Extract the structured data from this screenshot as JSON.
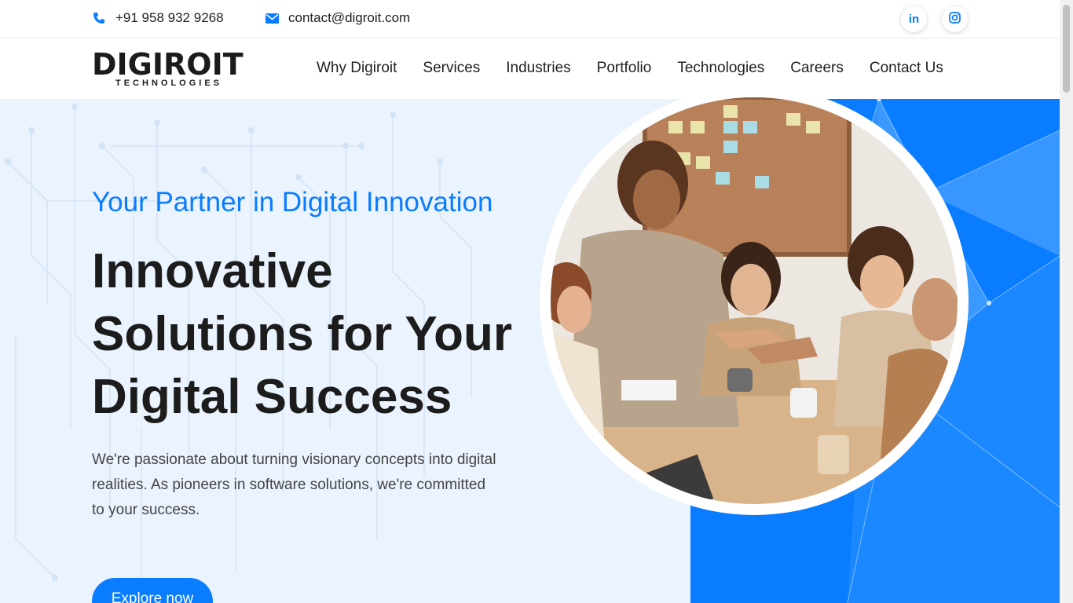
{
  "topbar": {
    "phone": "+91 958 932 9268",
    "email": "contact@digroit.com",
    "phone_icon": "phone-icon",
    "email_icon": "envelope-icon",
    "social": [
      {
        "icon": "linkedin-icon",
        "glyph": "in"
      },
      {
        "icon": "instagram-icon"
      }
    ]
  },
  "brand": {
    "name": "DIGIROIT",
    "sub": "TECHNOLOGIES"
  },
  "nav": {
    "items": [
      "Why Digiroit",
      "Services",
      "Industries",
      "Portfolio",
      "Technologies",
      "Careers",
      "Contact Us"
    ]
  },
  "hero": {
    "tagline": "Your Partner in Digital Innovation",
    "headline_lines": [
      "Innovative",
      "Solutions for Your",
      "Digital Success"
    ],
    "description": "We're passionate about turning visionary concepts into digital realities. As pioneers in software solutions, we're committed to your success.",
    "cta": "Explore now"
  },
  "colors": {
    "accent": "#0a7cff",
    "hero_bg": "#eaf3fe",
    "text_dark": "#1c1c1c"
  }
}
